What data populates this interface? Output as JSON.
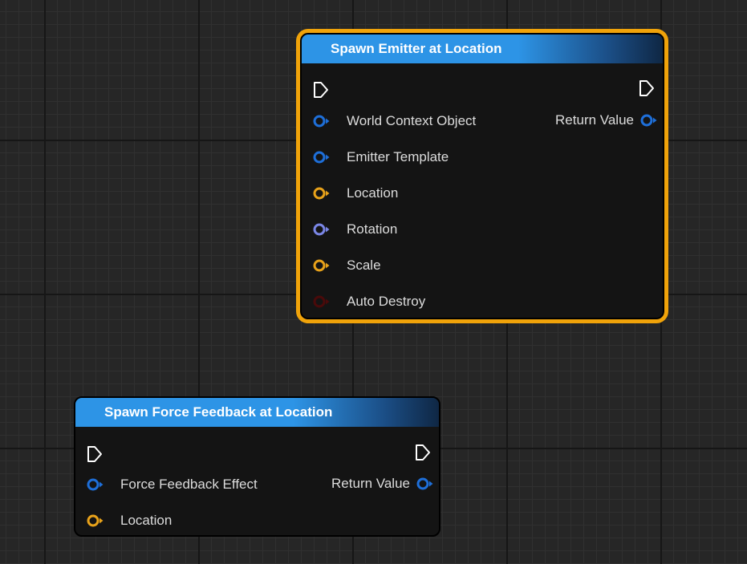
{
  "colors": {
    "object_pin": "#1e6fd9",
    "vector_pin": "#e8a21a",
    "rotator_pin": "#7a86e6",
    "bool_pin": "#4a0a0a",
    "selection_outline": "#f0a30a",
    "header_blue": "#2d94e6"
  },
  "node_emitter": {
    "title": "Spawn Emitter at Location",
    "selected": true,
    "exec_in_icon": "exec-in-icon",
    "exec_out_icon": "exec-out-icon",
    "inputs": [
      {
        "label": "World Context Object",
        "pin_type": "object"
      },
      {
        "label": "Emitter Template",
        "pin_type": "object"
      },
      {
        "label": "Location",
        "pin_type": "vector"
      },
      {
        "label": "Rotation",
        "pin_type": "rotator"
      },
      {
        "label": "Scale",
        "pin_type": "vector"
      },
      {
        "label": "Auto Destroy",
        "pin_type": "bool"
      }
    ],
    "output": {
      "label": "Return Value",
      "pin_type": "object"
    }
  },
  "node_force_feedback": {
    "title": "Spawn Force Feedback at Location",
    "selected": false,
    "exec_in_icon": "exec-in-icon",
    "exec_out_icon": "exec-out-icon",
    "inputs": [
      {
        "label": "Force Feedback Effect",
        "pin_type": "object"
      },
      {
        "label": "Location",
        "pin_type": "vector"
      }
    ],
    "output": {
      "label": "Return Value",
      "pin_type": "object"
    }
  }
}
